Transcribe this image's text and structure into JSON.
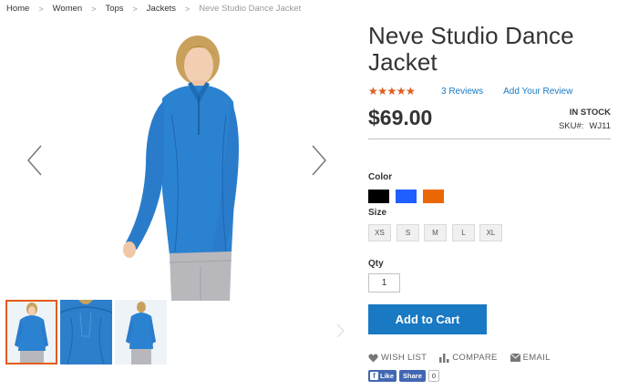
{
  "breadcrumb": {
    "items": [
      {
        "label": "Home"
      },
      {
        "label": "Women"
      },
      {
        "label": "Tops"
      },
      {
        "label": "Jackets"
      },
      {
        "label": "Neve Studio Dance Jacket"
      }
    ],
    "separator": ">"
  },
  "product": {
    "title": "Neve Studio Dance Jacket",
    "rating": {
      "stars_filled": 4.5,
      "stars_total": 5
    },
    "reviews_label": "3 Reviews",
    "add_review_label": "Add Your Review",
    "price": "$69.00",
    "stock": "IN STOCK",
    "sku_label": "SKU#:",
    "sku_value": "WJ11",
    "color_label": "Color",
    "colors": [
      {
        "name": "Black",
        "hex": "#000000"
      },
      {
        "name": "Blue",
        "hex": "#1f5fff"
      },
      {
        "name": "Orange",
        "hex": "#eb6703"
      }
    ],
    "size_label": "Size",
    "sizes": [
      "XS",
      "S",
      "M",
      "L",
      "XL"
    ],
    "qty_label": "Qty",
    "qty_value": "1",
    "add_to_cart_label": "Add to Cart",
    "actions": {
      "wishlist": "WISH LIST",
      "compare": "COMPARE",
      "email": "EMAIL"
    },
    "social": {
      "like": "Like",
      "share": "Share",
      "count": "0"
    }
  },
  "gallery": {
    "thumbnail_count": 3,
    "active_thumbnail": 0
  },
  "colors": {
    "accent_blue": "#1979c3",
    "rating_orange": "#e25c1d",
    "jacket_blue": "#2b82d0"
  }
}
